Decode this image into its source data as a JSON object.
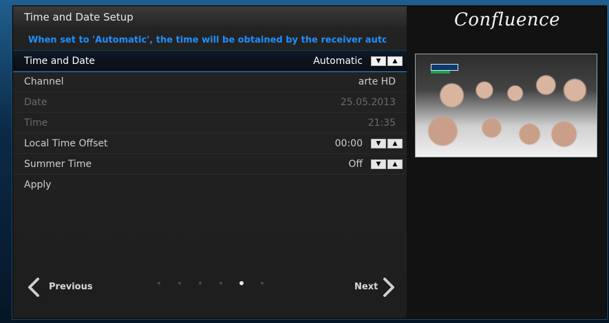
{
  "window": {
    "title": "Time and Date Setup",
    "hint": "When set to 'Automatic', the time will be obtained by the receiver automatical"
  },
  "settings": [
    {
      "label": "Time and Date",
      "value": "Automatic",
      "state": "focused",
      "has_spinner": true
    },
    {
      "label": "Channel",
      "value": "arte HD",
      "state": "normal",
      "has_spinner": false
    },
    {
      "label": "Date",
      "value": "25.05.2013",
      "state": "disabled",
      "has_spinner": false
    },
    {
      "label": "Time",
      "value": "21:35",
      "state": "disabled",
      "has_spinner": false
    },
    {
      "label": "Local Time Offset",
      "value": "00:00",
      "state": "normal",
      "has_spinner": true
    },
    {
      "label": "Summer Time",
      "value": "Off",
      "state": "normal",
      "has_spinner": true
    },
    {
      "label": "Apply",
      "value": "",
      "state": "normal",
      "has_spinner": false
    }
  ],
  "spinner": {
    "down_icon": "arrow-down-icon",
    "up_icon": "arrow-up-icon"
  },
  "navigation": {
    "previous_label": "Previous",
    "next_label": "Next",
    "page_count": 6,
    "active_page_index": 4
  },
  "branding": {
    "logo_text": "Confluence"
  },
  "preview": {
    "icon": "tv-preview"
  },
  "colors": {
    "hint_blue": "#1f8fff",
    "focus_line": "#1e7fd8",
    "text_normal": "#cfcfcf",
    "text_disabled": "#6a6a6a"
  }
}
